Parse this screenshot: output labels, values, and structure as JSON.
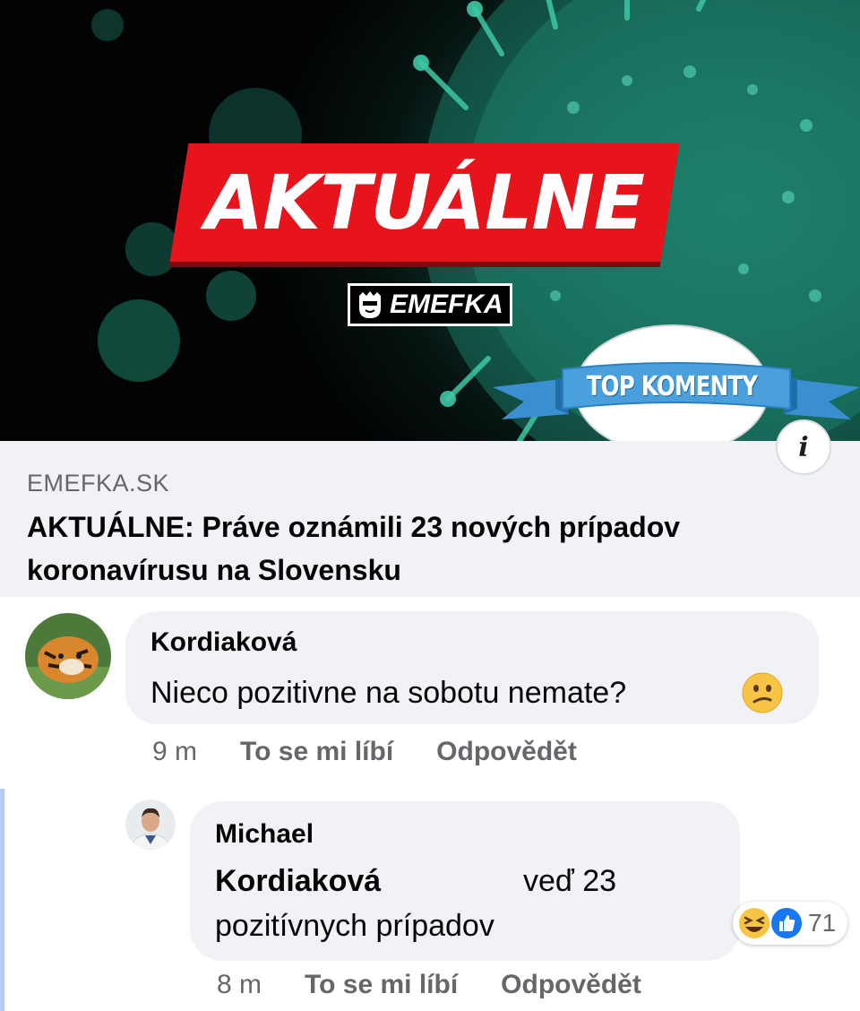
{
  "hero": {
    "banner_text": "AKTUÁLNE",
    "logo_text": "EMEFKA",
    "badge_text": "TOP KOMENTY"
  },
  "preview": {
    "domain": "EMEFKA.SK",
    "headline": "AKTUÁLNE: Práve oznámili 23 nových prípadov koronavírusu na Slovensku",
    "info_label": "i"
  },
  "comments": [
    {
      "author": "Kordiaková",
      "text": "Nieco pozitivne na sobotu nemate?",
      "emoji": "confused-face",
      "time": "9 m",
      "like_label": "To se mi líbí",
      "reply_label": "Odpovědět"
    },
    {
      "author": "Michael",
      "mention": "Kordiaková",
      "text_after_mention": "veď 23",
      "text_line2": "pozitívnych prípadov",
      "time": "8 m",
      "like_label": "To se mi líbí",
      "reply_label": "Odpovědět",
      "reactions": [
        "laughing-emoji",
        "like-thumb"
      ],
      "reaction_count": "71"
    }
  ],
  "colors": {
    "banner_red": "#e8141c",
    "badge_blue": "#3a8fd0",
    "fb_like_blue": "#1877f2",
    "bubble_grey": "#f0f2f5",
    "meta_grey": "#65676b"
  }
}
